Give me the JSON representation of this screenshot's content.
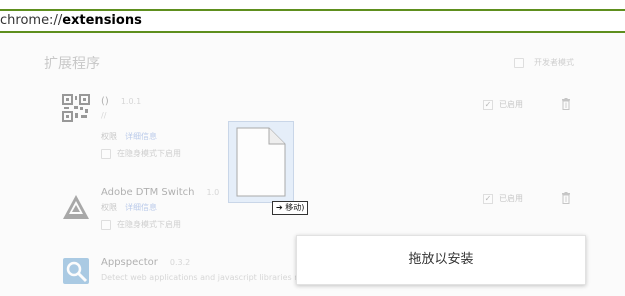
{
  "address_bar": {
    "scheme": "chrome://",
    "host": "extensions"
  },
  "page": {
    "title": "扩展程序",
    "developer_mode_label": "开发者模式"
  },
  "extensions": [
    {
      "name": "()",
      "version": "1.0.1",
      "description": "//",
      "permissions_label": "权限",
      "details_label": "详细信息",
      "incognito_label": "在隐身模式下启用",
      "enabled_label": "已启用",
      "enabled": true,
      "icon": "qr-code-icon"
    },
    {
      "name": "Adobe DTM Switch",
      "version": "1.0",
      "description": "",
      "permissions_label": "权限",
      "details_label": "详细信息",
      "incognito_label": "在隐身模式下启用",
      "enabled_label": "已启用",
      "enabled": true,
      "icon": "adobe-dtm-icon"
    },
    {
      "name": "Appspector",
      "version": "0.3.2",
      "description": "Detect web applications and javascript libraries run on browsing website.",
      "icon": "appspector-icon"
    }
  ],
  "drag": {
    "move_label": "➔ 移动)"
  },
  "drop_panel": {
    "label": "拖放以安装"
  },
  "colors": {
    "accent_green": "#5e8f1e",
    "link_blue": "#6b8fd6"
  }
}
